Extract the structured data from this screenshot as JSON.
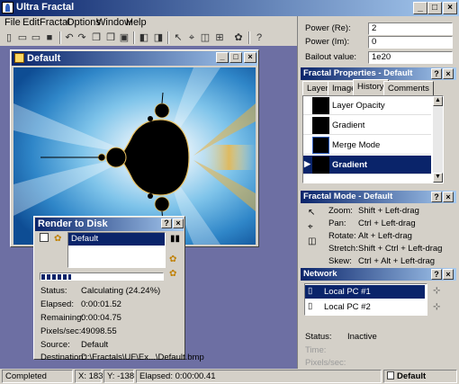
{
  "app": {
    "title": "Ultra Fractal"
  },
  "menu": [
    "File",
    "Edit",
    "Fractal",
    "Options",
    "Window",
    "Help"
  ],
  "fractal_window": {
    "title": "Default"
  },
  "parameters": {
    "power_re_label": "Power (Re):",
    "power_re_value": "2",
    "power_im_label": "Power (Im):",
    "power_im_value": "0",
    "bailout_label": "Bailout value:",
    "bailout_value": "1e20"
  },
  "fractal_properties": {
    "title": "Fractal Properties - Default",
    "tabs": [
      "Layers",
      "Image",
      "History",
      "Comments"
    ],
    "active_tab": "History",
    "history": [
      "Layer Opacity",
      "Gradient",
      "Merge Mode",
      "Gradient"
    ]
  },
  "fractal_mode": {
    "title": "Fractal Mode - Default",
    "rows": [
      {
        "label": "Zoom:",
        "value": "Shift + Left-drag"
      },
      {
        "label": "Pan:",
        "value": "Ctrl + Left-drag"
      },
      {
        "label": "Rotate:",
        "value": "Alt + Left-drag"
      },
      {
        "label": "Stretch:",
        "value": "Shift + Ctrl + Left-drag"
      },
      {
        "label": "Skew:",
        "value": "Ctrl + Alt + Left-drag"
      }
    ]
  },
  "network": {
    "title": "Network",
    "items": [
      "Local PC #1",
      "Local PC #2"
    ],
    "status_label": "Status:",
    "status_value": "Inactive",
    "time_label": "Time:",
    "pixels_label": "Pixels/sec:"
  },
  "render": {
    "title": "Render to Disk",
    "item": "Default",
    "progress": 0.2424,
    "rows": [
      {
        "label": "Status:",
        "value": "Calculating (24.24%)"
      },
      {
        "label": "Elapsed:",
        "value": "0:00:01.52"
      },
      {
        "label": "Remaining:",
        "value": "0:00:04.75"
      },
      {
        "label": "Pixels/sec:",
        "value": "49098.55"
      },
      {
        "label": "Source:",
        "value": "Default"
      },
      {
        "label": "Destination:",
        "value": "D:\\Fractals\\UF\\Ex...\\Default.bmp"
      }
    ]
  },
  "statusbar": {
    "state": "Completed",
    "x": "X: 183",
    "y": "Y: -138",
    "elapsed": "Elapsed: 0:00:00.41",
    "document": "Default"
  },
  "colors": {
    "title_start": "#0a246a",
    "title_end": "#a6caf0",
    "workspace": "#6d6fa3",
    "selection": "#0a246a"
  }
}
